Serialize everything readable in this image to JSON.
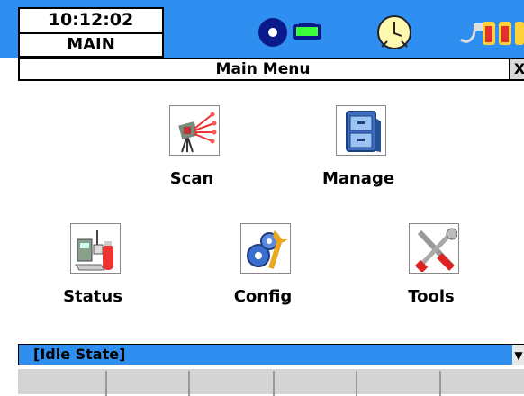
{
  "status_bar": {
    "time": "10:12:02",
    "app_name": "MAIN",
    "icons": [
      "disc-icon",
      "battery-icon",
      "clock-icon",
      "power-icon"
    ]
  },
  "window": {
    "title": "Main Menu",
    "close_label": "X"
  },
  "menu": [
    {
      "label": "Scan",
      "icon": "scanner-icon"
    },
    {
      "label": "Manage",
      "icon": "file-cabinet-icon"
    },
    {
      "label": "Status",
      "icon": "status-icon"
    },
    {
      "label": "Config",
      "icon": "gear-wrench-icon"
    },
    {
      "label": "Tools",
      "icon": "tools-icon"
    }
  ],
  "state": {
    "text": "[Idle State]",
    "arrow": "▼"
  },
  "softkeys": [
    "",
    "",
    "",
    "",
    "",
    ""
  ],
  "colors": {
    "bar_blue": "#2f8ff0"
  }
}
